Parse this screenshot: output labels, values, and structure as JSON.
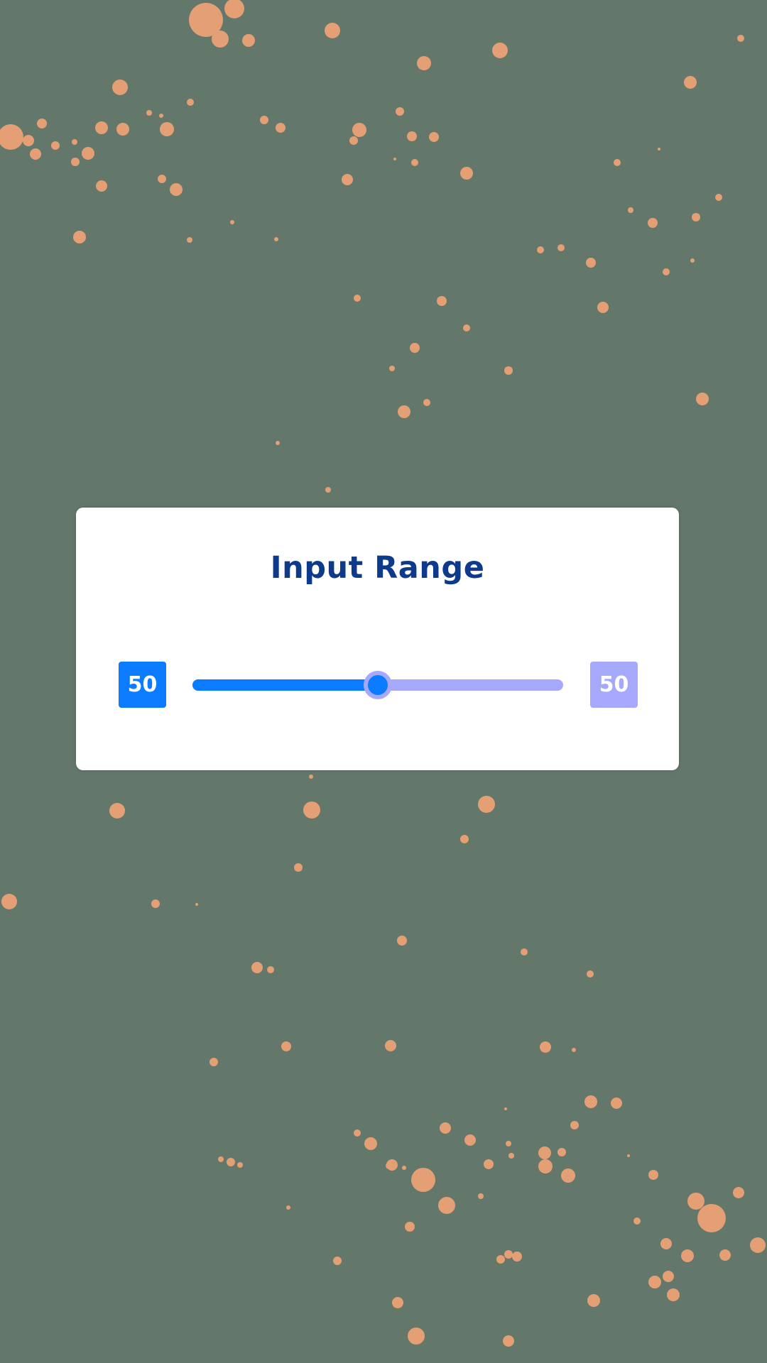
{
  "widget": {
    "title": "Input Range",
    "range": {
      "min": 0,
      "max": 100,
      "value": 50
    },
    "left_value_label": "50",
    "right_value_label": "50"
  },
  "colors": {
    "background": "#63786b",
    "splatter": "#e59f74",
    "card": "#ffffff",
    "title": "#0e3a8c",
    "accent": "#0b7bff",
    "track": "#a6a9fb"
  }
}
